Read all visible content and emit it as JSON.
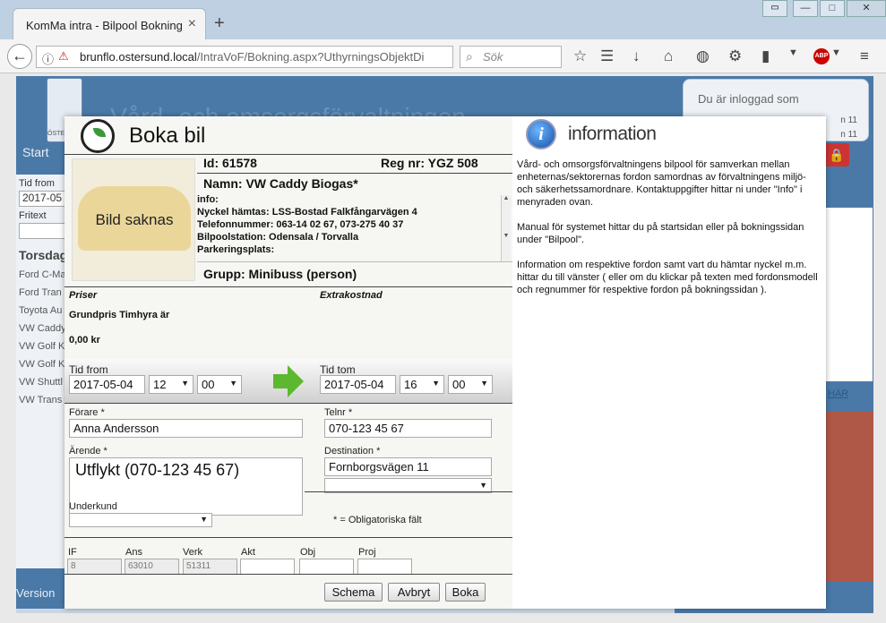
{
  "browser": {
    "tab_title": "KomMa intra - Bilpool Bokning",
    "tab_close": "×",
    "new_tab": "+",
    "url_host": "brunflo.ostersund.local",
    "url_path": "/IntraVoF/Bokning.aspx?UthyrningsObjektDi",
    "search_placeholder": "Sök",
    "abp": "ABP"
  },
  "page": {
    "header_title": "Vård- och omsorgsförvaltningen",
    "crest_text": "ÖSTERSUND",
    "start": "Start",
    "version": "Version",
    "left_panel": {
      "tid_from_label": "Tid from",
      "tid_from_value": "2017-05",
      "fritext_label": "Fritext",
      "day_heading": "Torsdag",
      "vehicles": [
        "Ford C-Ma",
        "Ford Tran",
        "Toyota Au",
        "VW Caddy",
        "VW Golf K",
        "VW Golf K",
        "VW Shuttl",
        "VW Trans"
      ]
    },
    "login": {
      "label": "Du är inloggad som",
      "line1": "n 11",
      "line2": "n 11"
    },
    "right_link": "HÄR"
  },
  "modal": {
    "title": "Boka bil",
    "vehicle": {
      "photo_text": "Bild saknas",
      "id": "Id: 61578",
      "reg": "Reg nr: YGZ 508",
      "name": "Namn: VW Caddy Biogas*",
      "info_lines": [
        "info:",
        "Nyckel hämtas: LSS-Bostad Falkfångarvägen 4",
        "Telefonnummer: 063-14 02 67, 073-275 40 37",
        "Bilpoolstation: Odensala / Torvalla",
        "Parkeringsplats:"
      ],
      "group": "Grupp: Minibuss (person)"
    },
    "prices": {
      "priser_label": "Priser",
      "extra_label": "Extrakostnad",
      "grundpris_label": "Grundpris Timhyra är",
      "amount": "0,00 kr"
    },
    "time": {
      "from_label": "Tid from",
      "from_date": "2017-05-04",
      "from_hour": "12",
      "from_min": "00",
      "to_label": "Tid tom",
      "to_date": "2017-05-04",
      "to_hour": "16",
      "to_min": "00"
    },
    "form": {
      "forare_label": "Förare *",
      "forare_value": "Anna Andersson",
      "telnr_label": "Telnr *",
      "telnr_value": "070-123 45 67",
      "arende_label": "Ärende *",
      "arende_value": "Utflykt (070-123 45 67)",
      "destination_label": "Destination *",
      "destination_value": "Fornborgsvägen 11",
      "underkund_label": "Underkund",
      "obligatory_note": "* = Obligatoriska fält"
    },
    "accounting": {
      "labels": [
        "IF",
        "Ans",
        "Verk",
        "Akt",
        "Obj",
        "Proj"
      ],
      "values": [
        "8",
        "63010",
        "51311",
        "",
        "",
        ""
      ]
    },
    "buttons": {
      "schema": "Schema",
      "avbryt": "Avbryt",
      "boka": "Boka"
    },
    "info_panel": {
      "title": "information",
      "icon": "i",
      "paragraphs": [
        "Vård- och omsorgsförvaltningens bilpool för samverkan mellan enheternas/sektorernas fordon samordnas av förvaltningens miljö- och säkerhetssamordnare. Kontaktuppgifter hittar ni under \"Info\" i menyraden ovan.",
        "Manual för systemet hittar du på startsidan eller på bokningssidan under \"Bilpool\".",
        "Information om respektive fordon samt vart du hämtar nyckel m.m. hittar du till vänster ( eller om du klickar på texten med fordonsmodell och regnummer för respektive fordon på bokningssidan )."
      ]
    }
  }
}
